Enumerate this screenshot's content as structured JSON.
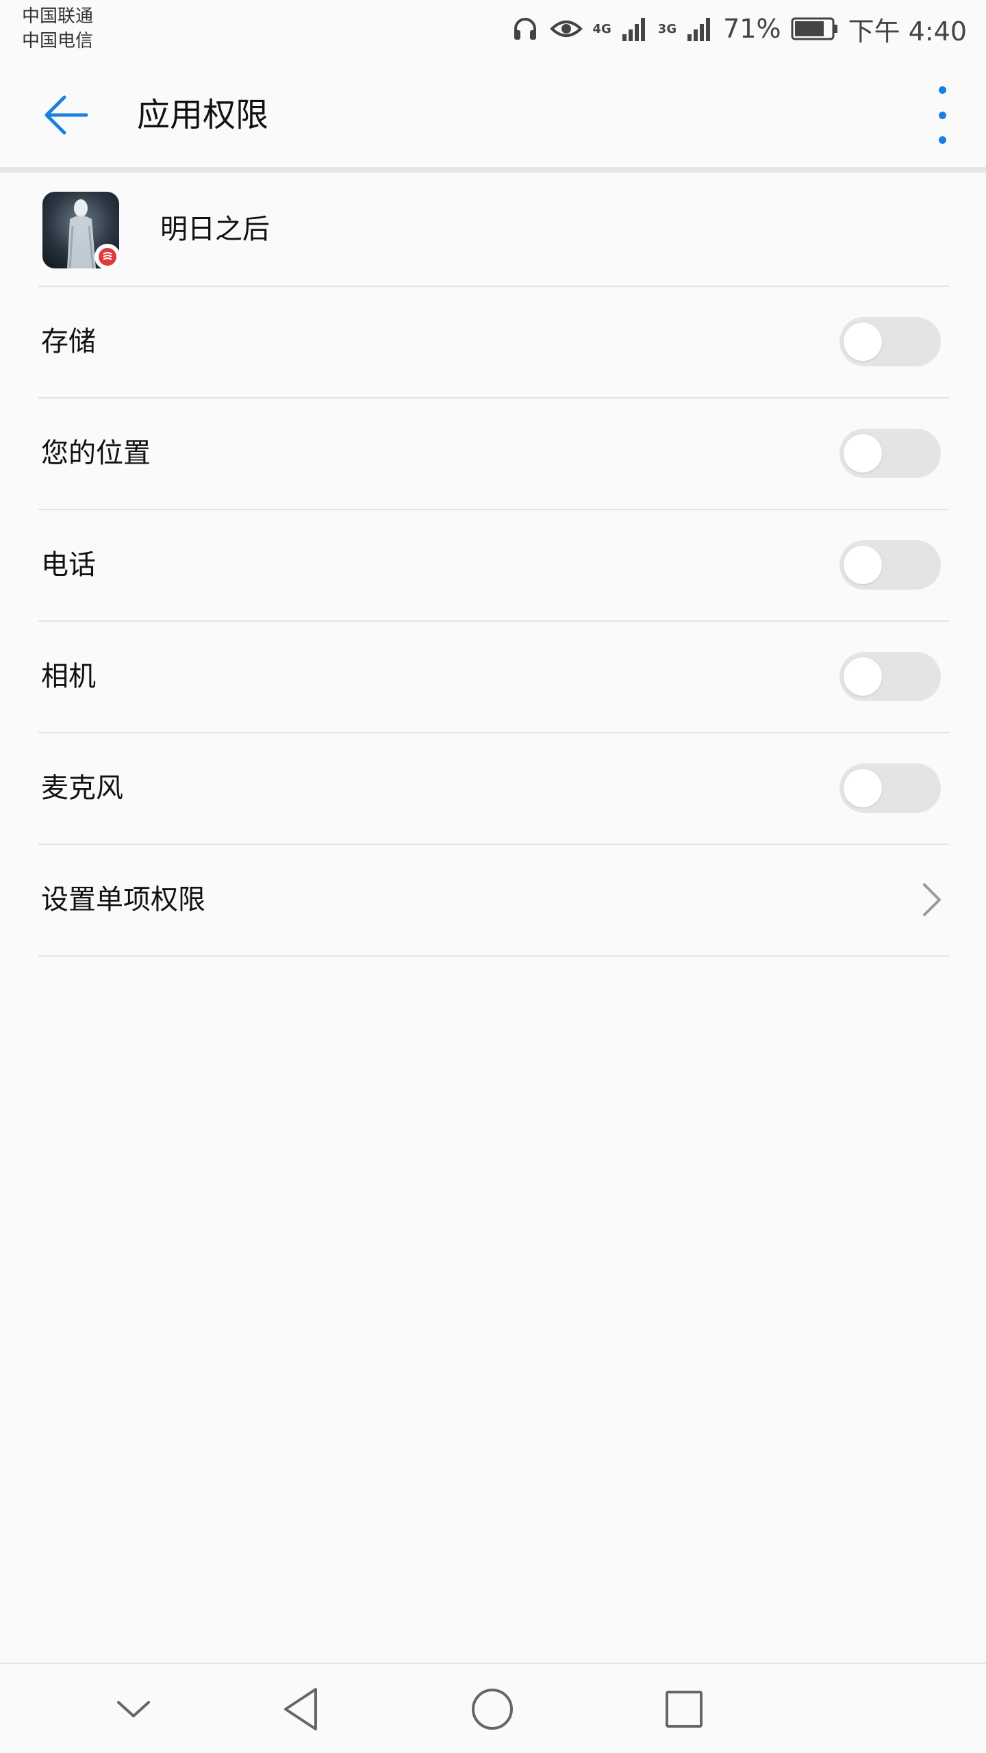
{
  "status_bar": {
    "carrier1": "中国联通",
    "carrier2": "中国电信",
    "network1": "4G",
    "network2": "3G",
    "battery": "71%",
    "time": "下午 4:40",
    "icons": [
      "headset-icon",
      "eye-icon",
      "signal-icon",
      "signal-icon",
      "battery-icon"
    ]
  },
  "header": {
    "title": "应用权限",
    "back_icon": "back-arrow-icon",
    "more_icon": "more-vertical-icon",
    "accent_color": "#1a7fe0"
  },
  "app": {
    "name": "明日之后"
  },
  "permissions": [
    {
      "label": "存储",
      "enabled": false
    },
    {
      "label": "您的位置",
      "enabled": false
    },
    {
      "label": "电话",
      "enabled": false
    },
    {
      "label": "相机",
      "enabled": false
    },
    {
      "label": "麦克风",
      "enabled": false
    }
  ],
  "single_permission": {
    "label": "设置单项权限",
    "icon": "chevron-right-icon"
  },
  "nav_bar": {
    "icons": [
      "collapse-icon",
      "back-triangle-icon",
      "home-circle-icon",
      "recents-square-icon"
    ]
  }
}
